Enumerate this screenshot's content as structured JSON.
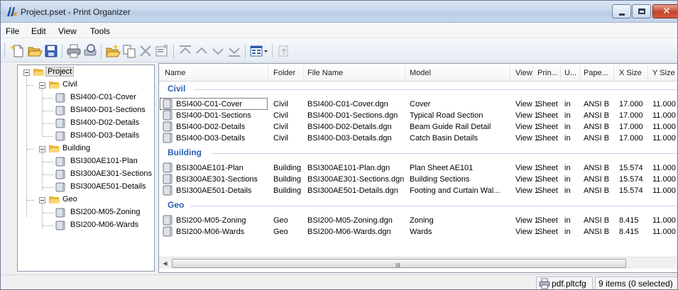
{
  "window": {
    "title": "Project.pset - Print Organizer",
    "icon": "print-organizer-app-icon",
    "controls": [
      "minimize-icon",
      "maximize-icon",
      "close-icon"
    ]
  },
  "menu": [
    "File",
    "Edit",
    "View",
    "Tools"
  ],
  "toolbar": {
    "buttons": [
      "new-icon",
      "open-icon",
      "save-icon",
      "print-icon",
      "print-preview-icon",
      "add-files-icon",
      "copy-icon",
      "delete-icon",
      "properties-icon",
      "move-top-icon",
      "move-up-icon",
      "move-down-icon",
      "move-bottom-icon",
      "view-mode-icon",
      "dropdown-arrow-icon",
      "disabled-action-icon"
    ]
  },
  "tree": {
    "root": "Project",
    "folders": [
      {
        "name": "Civil",
        "items": [
          "BSI400-C01-Cover",
          "BSI400-D01-Sections",
          "BSI400-D02-Details",
          "BSI400-D03-Details"
        ]
      },
      {
        "name": "Building",
        "items": [
          "BSI300AE101-Plan",
          "BSI300AE301-Sections",
          "BSI300AE501-Details"
        ]
      },
      {
        "name": "Geo",
        "items": [
          "BSI200-M05-Zoning",
          "BSI200-M06-Wards"
        ]
      }
    ]
  },
  "list": {
    "columns": [
      "Name",
      "Folder",
      "File Name",
      "Model",
      "View",
      "Prin...",
      "U...",
      "Pape...",
      "X Size",
      "Y Size"
    ],
    "groups": [
      {
        "title": "Civil",
        "rows": [
          [
            "BSI400-C01-Cover",
            "Civil",
            "BSI400-C01-Cover.dgn",
            "Cover",
            "View 1",
            "Sheet",
            "in",
            "ANSI B",
            "17.000",
            "11.000"
          ],
          [
            "BSI400-D01-Sections",
            "Civil",
            "BSI400-D01-Sections.dgn",
            "Typical Road Section",
            "View 1",
            "Sheet",
            "in",
            "ANSI B",
            "17.000",
            "11.000"
          ],
          [
            "BSI400-D02-Details",
            "Civil",
            "BSI400-D02-Details.dgn",
            "Beam Guide Rail Detail",
            "View 1",
            "Sheet",
            "in",
            "ANSI B",
            "17.000",
            "11.000"
          ],
          [
            "BSI400-D03-Details",
            "Civil",
            "BSI400-D03-Details.dgn",
            "Catch Basin Details",
            "View 1",
            "Sheet",
            "in",
            "ANSI B",
            "17.000",
            "11.000"
          ]
        ]
      },
      {
        "title": "Building",
        "rows": [
          [
            "BSI300AE101-Plan",
            "Building",
            "BSI300AE101-Plan.dgn",
            "Plan Sheet AE101",
            "View 1",
            "Sheet",
            "in",
            "ANSI B",
            "15.574",
            "11.000"
          ],
          [
            "BSI300AE301-Sections",
            "Building",
            "BSI300AE301-Sections.dgn",
            "Building Sections",
            "View 1",
            "Sheet",
            "in",
            "ANSI B",
            "15.574",
            "11.000"
          ],
          [
            "BSI300AE501-Details",
            "Building",
            "BSI300AE501-Details.dgn",
            "Footing and Curtain Wal...",
            "View 1",
            "Sheet",
            "in",
            "ANSI B",
            "15.574",
            "11.000"
          ]
        ]
      },
      {
        "title": "Geo",
        "rows": [
          [
            "BSI200-M05-Zoning",
            "Geo",
            "BSI200-M05-Zoning.dgn",
            "Zoning",
            "View 1",
            "Sheet",
            "in",
            "ANSI B",
            "8.415",
            "11.000"
          ],
          [
            "BSI200-M06-Wards",
            "Geo",
            "BSI200-M06-Wards.dgn",
            "Wards",
            "View 1",
            "Sheet",
            "in",
            "ANSI B",
            "8.415",
            "11.000"
          ]
        ]
      }
    ],
    "scroll_grip": "III"
  },
  "status": {
    "printer_config": "pdf.pltcfg",
    "selection": "9 items (0 selected)",
    "printer_icon": "printer-icon"
  },
  "colors": {
    "group_title": "#2b5fb4",
    "selection_border": "#000000",
    "folder_yellow": "#f4c542"
  }
}
